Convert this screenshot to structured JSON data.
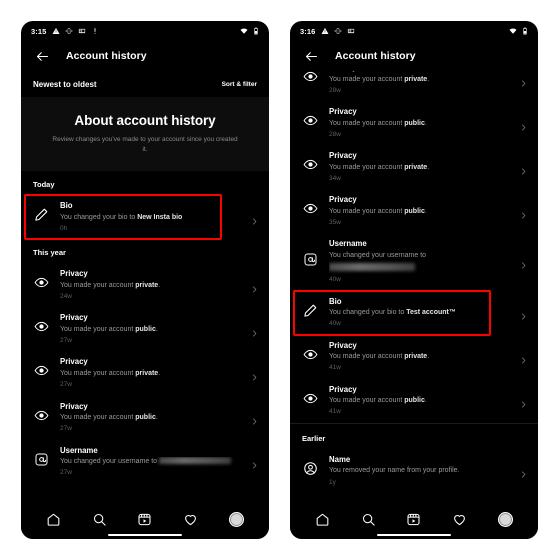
{
  "app": {
    "title": "Account history",
    "back_icon": "back-arrow-icon"
  },
  "panels": [
    {
      "id": "left",
      "statusbar": {
        "time": "3:15",
        "left_icons": [
          "warning-triangle-icon",
          "vibrate-icon",
          "sim-card-icon",
          "exclamation-icon"
        ],
        "right_icons": [
          "wifi-icon",
          "battery-icon"
        ]
      },
      "sortbar": {
        "label": "Newest to oldest",
        "action": "Sort & filter"
      },
      "about": {
        "title": "About account history",
        "subtitle": "Review changes you've made to your account since you created it."
      },
      "sections": [
        {
          "heading": "Today",
          "divided": false,
          "items": [
            {
              "icon": "pencil-icon",
              "title": "Bio",
              "desc_prefix": "You changed your bio to ",
              "desc_bold": "New Insta bio",
              "desc_suffix": "",
              "time": "0h",
              "redacted": false,
              "highlighted": true
            }
          ]
        },
        {
          "heading": "This year",
          "divided": false,
          "items": [
            {
              "icon": "eye-icon",
              "title": "Privacy",
              "desc_prefix": "You made your account ",
              "desc_bold": "private",
              "desc_suffix": ".",
              "time": "24w",
              "redacted": false,
              "highlighted": false
            },
            {
              "icon": "eye-icon",
              "title": "Privacy",
              "desc_prefix": "You made your account ",
              "desc_bold": "public",
              "desc_suffix": ".",
              "time": "27w",
              "redacted": false,
              "highlighted": false
            },
            {
              "icon": "eye-icon",
              "title": "Privacy",
              "desc_prefix": "You made your account ",
              "desc_bold": "private",
              "desc_suffix": ".",
              "time": "27w",
              "redacted": false,
              "highlighted": false
            },
            {
              "icon": "eye-icon",
              "title": "Privacy",
              "desc_prefix": "You made your account ",
              "desc_bold": "public",
              "desc_suffix": ".",
              "time": "27w",
              "redacted": false,
              "highlighted": false
            },
            {
              "icon": "at-sign-icon",
              "title": "Username",
              "desc_prefix": "You changed your username to",
              "desc_bold": "",
              "desc_suffix": "",
              "time": "27w",
              "redacted": true,
              "redacted_inline": true,
              "highlighted": false
            }
          ]
        }
      ],
      "bottomnav": {
        "items": [
          "home-icon",
          "search-icon",
          "reels-icon",
          "heart-icon",
          "profile-avatar"
        ],
        "active": "reels-icon"
      }
    },
    {
      "id": "right",
      "statusbar": {
        "time": "3:16",
        "left_icons": [
          "warning-triangle-icon",
          "vibrate-icon",
          "sim-card-icon"
        ],
        "right_icons": [
          "wifi-icon",
          "battery-icon"
        ]
      },
      "sections": [
        {
          "heading": "",
          "divided": false,
          "clipped_top": true,
          "items": [
            {
              "icon": "eye-icon",
              "title": "Privacy",
              "desc_prefix": "You made your account ",
              "desc_bold": "private",
              "desc_suffix": ".",
              "time": "28w",
              "redacted": false,
              "highlighted": false
            },
            {
              "icon": "eye-icon",
              "title": "Privacy",
              "desc_prefix": "You made your account ",
              "desc_bold": "public",
              "desc_suffix": ".",
              "time": "28w",
              "redacted": false,
              "highlighted": false
            },
            {
              "icon": "eye-icon",
              "title": "Privacy",
              "desc_prefix": "You made your account ",
              "desc_bold": "private",
              "desc_suffix": ".",
              "time": "34w",
              "redacted": false,
              "highlighted": false
            },
            {
              "icon": "eye-icon",
              "title": "Privacy",
              "desc_prefix": "You made your account ",
              "desc_bold": "public",
              "desc_suffix": ".",
              "time": "35w",
              "redacted": false,
              "highlighted": false
            },
            {
              "icon": "at-sign-icon",
              "title": "Username",
              "desc_prefix": "You changed your username to",
              "desc_bold": "",
              "desc_suffix": "",
              "time": "40w",
              "redacted": true,
              "redacted_inline": false,
              "highlighted": false
            },
            {
              "icon": "pencil-icon",
              "title": "Bio",
              "desc_prefix": "You changed your bio to ",
              "desc_bold": "Test account™",
              "desc_suffix": "",
              "time": "40w",
              "redacted": false,
              "highlighted": true
            },
            {
              "icon": "eye-icon",
              "title": "Privacy",
              "desc_prefix": "You made your account ",
              "desc_bold": "private",
              "desc_suffix": ".",
              "time": "41w",
              "redacted": false,
              "highlighted": false
            },
            {
              "icon": "eye-icon",
              "title": "Privacy",
              "desc_prefix": "You made your account ",
              "desc_bold": "public",
              "desc_suffix": ".",
              "time": "41w",
              "redacted": false,
              "highlighted": false
            }
          ]
        },
        {
          "heading": "Earlier",
          "divided": true,
          "items": [
            {
              "icon": "person-circle-icon",
              "title": "Name",
              "desc_prefix": "You removed your name from your profile.",
              "desc_bold": "",
              "desc_suffix": "",
              "time": "1y",
              "redacted": false,
              "highlighted": false
            }
          ]
        }
      ],
      "bottomnav": {
        "items": [
          "home-icon",
          "search-icon",
          "reels-icon",
          "heart-icon",
          "profile-avatar"
        ],
        "active": "reels-icon"
      }
    }
  ],
  "colors": {
    "background": "#000000",
    "page": "#ffffff",
    "highlight": "#ff0000",
    "card": "#0d0d0d",
    "muted_text": "#9a9a9a",
    "time_text": "#5f5f5f"
  }
}
